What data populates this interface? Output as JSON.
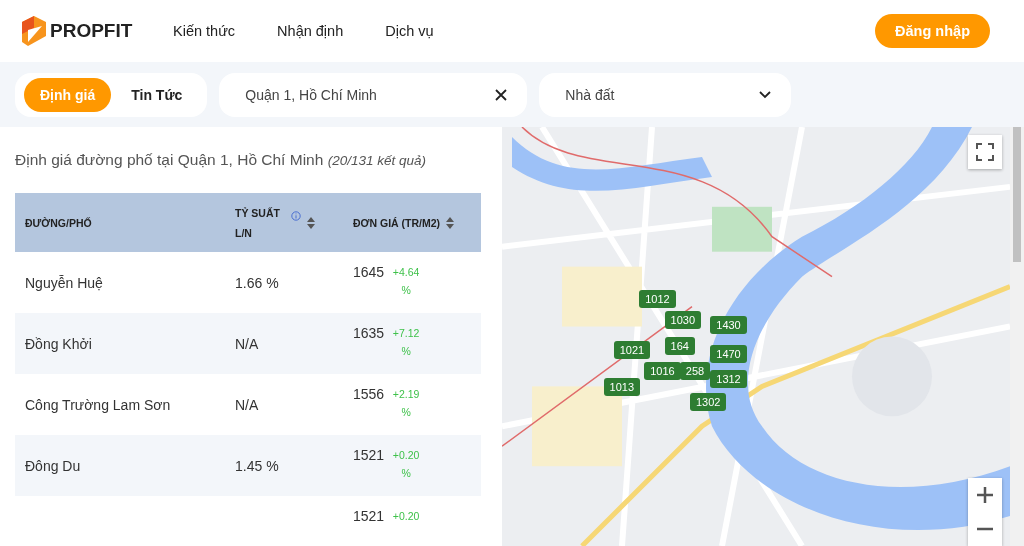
{
  "header": {
    "brand": "PROPFIT",
    "nav": [
      {
        "label": "Kiến thức"
      },
      {
        "label": "Nhận định"
      },
      {
        "label": "Dịch vụ"
      }
    ],
    "login": "Đăng nhập"
  },
  "filters": {
    "tabs": [
      {
        "label": "Định giá",
        "selected": true
      },
      {
        "label": "Tin Tức",
        "selected": false
      }
    ],
    "location": {
      "value": "Quận 1, Hồ Chí Minh"
    },
    "property_type": {
      "value": "Nhà đất"
    }
  },
  "results": {
    "title": "Định giá đường phố tại Quận 1, Hồ Chí Minh",
    "count": "(20/131 kết quả)"
  },
  "table": {
    "columns": [
      {
        "label": "ĐƯỜNG/PHỐ",
        "sortable": false,
        "info": false
      },
      {
        "label": "TỶ SUẤT L/N",
        "sortable": true,
        "info": true
      },
      {
        "label": "ĐƠN GIÁ (TR/M2)",
        "sortable": true,
        "info": false
      }
    ],
    "rows": [
      {
        "street": "Nguyễn Huệ",
        "yield": "1.66 %",
        "price": "1645",
        "change": "+4.64 %"
      },
      {
        "street": "Đồng Khởi",
        "yield": "N/A",
        "price": "1635",
        "change": "+7.12 %"
      },
      {
        "street": "Công Trường Lam Sơn",
        "yield": "N/A",
        "price": "1556",
        "change": "+2.19 %"
      },
      {
        "street": "Đông Du",
        "yield": "1.45 %",
        "price": "1521",
        "change": "+0.20 %"
      },
      {
        "price": "1521",
        "change": "+0.20"
      }
    ]
  },
  "map": {
    "markers": [
      {
        "label": "1012"
      },
      {
        "label": "1030"
      },
      {
        "label": "164"
      },
      {
        "label": "1430"
      },
      {
        "label": "1470"
      },
      {
        "label": "1021"
      },
      {
        "label": "1016"
      },
      {
        "label": "258"
      },
      {
        "label": "1013"
      },
      {
        "label": "1312"
      },
      {
        "label": "1302"
      }
    ]
  }
}
